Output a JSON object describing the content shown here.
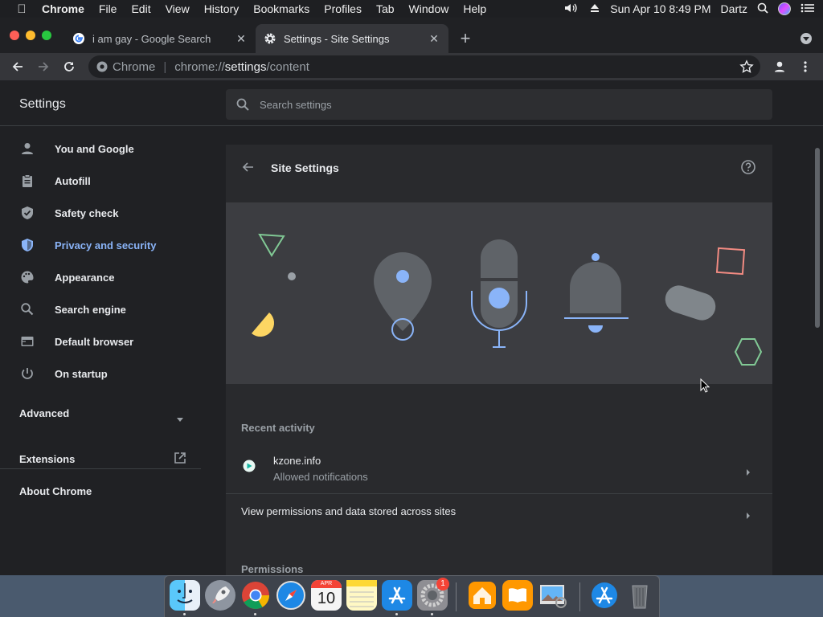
{
  "menubar": {
    "app": "Chrome",
    "menus": [
      "File",
      "Edit",
      "View",
      "History",
      "Bookmarks",
      "Profiles",
      "Tab",
      "Window",
      "Help"
    ],
    "datetime": "Sun Apr 10  8:49 PM",
    "user": "Dartz"
  },
  "tabs": [
    {
      "title": "i am gay - Google Search",
      "favicon": "google-icon"
    },
    {
      "title": "Settings - Site Settings",
      "favicon": "gear-icon"
    }
  ],
  "omnibox": {
    "origin": "Chrome",
    "url_prefix": "chrome://",
    "url_host": "settings",
    "url_path": "/content"
  },
  "settings": {
    "title": "Settings",
    "search_placeholder": "Search settings",
    "nav": [
      {
        "label": "You and Google",
        "icon": "person-icon"
      },
      {
        "label": "Autofill",
        "icon": "clipboard-icon"
      },
      {
        "label": "Safety check",
        "icon": "shield-check-icon"
      },
      {
        "label": "Privacy and security",
        "icon": "shield-icon",
        "active": true
      },
      {
        "label": "Appearance",
        "icon": "palette-icon"
      },
      {
        "label": "Search engine",
        "icon": "search-icon"
      },
      {
        "label": "Default browser",
        "icon": "browser-icon"
      },
      {
        "label": "On startup",
        "icon": "power-icon"
      }
    ],
    "advanced": "Advanced",
    "extensions": "Extensions",
    "about": "About Chrome"
  },
  "content": {
    "title": "Site Settings",
    "recent_activity_label": "Recent activity",
    "recent": [
      {
        "site": "kzone.info",
        "detail": "Allowed notifications"
      }
    ],
    "view_permissions": "View permissions and data stored across sites",
    "permissions_label": "Permissions"
  },
  "dock": {
    "apps": [
      "finder-icon",
      "launchpad-icon",
      "chrome-icon",
      "safari-icon",
      "calendar-icon",
      "notes-icon",
      "app-store-icon",
      "system-preferences-icon",
      "home-icon",
      "books-icon",
      "preview-icon",
      "app-store-downloads-icon",
      "trash-icon"
    ],
    "calendar_month": "APR",
    "calendar_day": "10",
    "badge": "1"
  },
  "colors": {
    "accent": "#8ab4f8",
    "background": "#202124",
    "card": "#292a2d"
  }
}
